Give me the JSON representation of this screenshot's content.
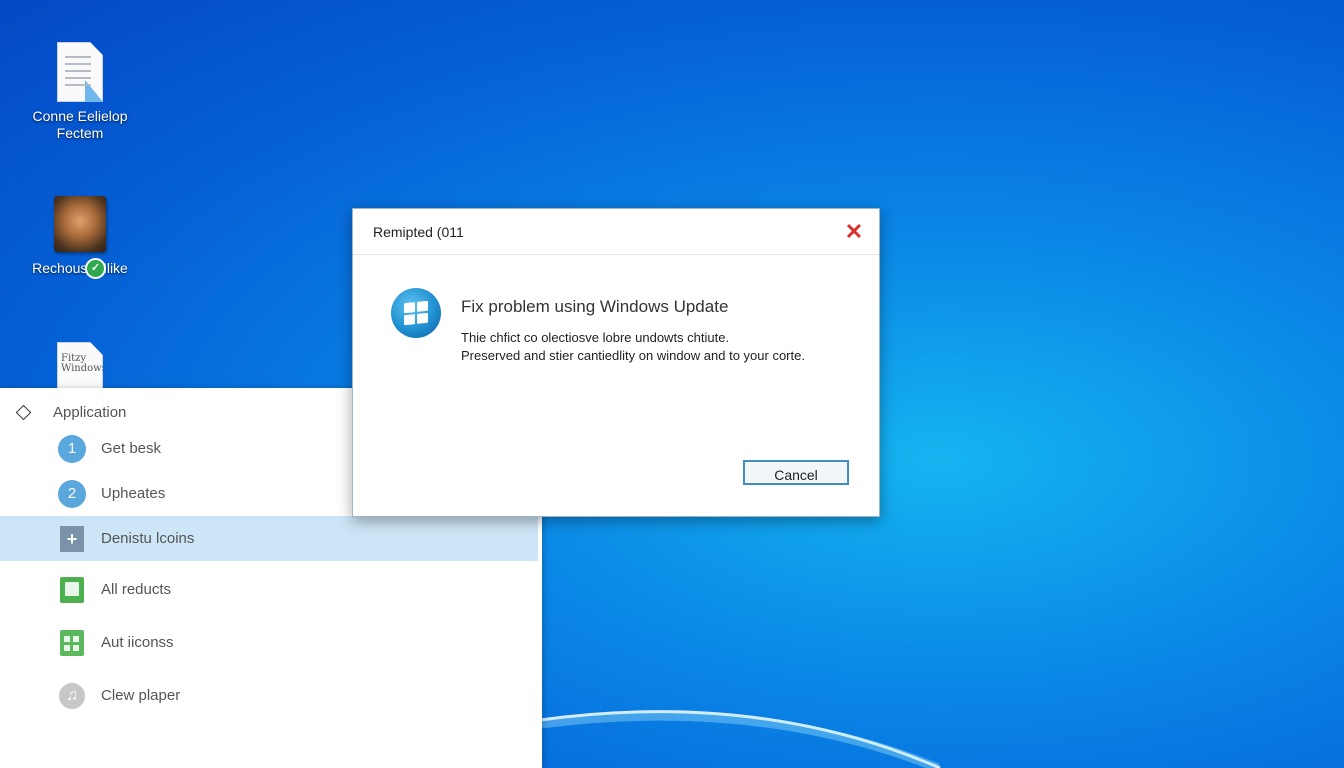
{
  "desktop": {
    "icons": [
      {
        "label": "Conne Eelielop\nFectem"
      },
      {
        "label": "Rechoust Mlike"
      },
      {
        "label": "",
        "doc_text": "Fitzy\nWindows"
      }
    ]
  },
  "app_panel": {
    "header": "Application",
    "items": [
      {
        "label": "Get besk",
        "icon_text": "1",
        "icon": "number-1-icon"
      },
      {
        "label": "Upheates",
        "icon_text": "2",
        "icon": "number-2-icon"
      },
      {
        "label": "Denistu lcoins",
        "icon_text": "+",
        "icon": "plus-square-icon",
        "selected": true
      },
      {
        "label": "All reducts",
        "icon": "green-app-icon"
      },
      {
        "label": "Aut iiconss",
        "icon": "grid-app-icon"
      },
      {
        "label": "Clew plaper",
        "icon": "music-icon"
      }
    ]
  },
  "dialog": {
    "title": "Remipted (011",
    "close_symbol": "✕",
    "heading": "Fix problem using Windows Update",
    "message_line1": "Thie chfict co olectiosve lobre undowts chtiute.",
    "message_line2": "Preserved and stier cantiedlity on window and to your corte.",
    "cancel_label": "Cancel"
  },
  "colors": {
    "desktop_blue": "#0a86e6",
    "selection": "#cde6f7",
    "close_red": "#d9312b",
    "button_border": "#3d8dcb"
  }
}
